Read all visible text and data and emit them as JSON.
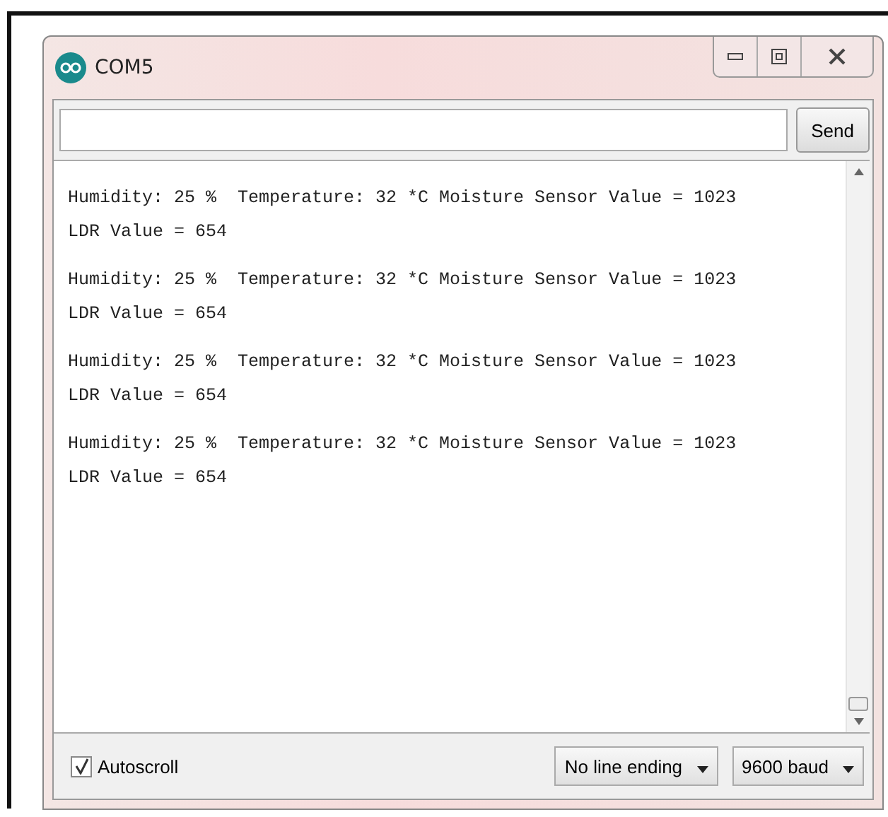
{
  "window": {
    "title": "COM5"
  },
  "send_button": "Send",
  "output": [
    {
      "lines": [
        "Humidity: 25 %  Temperature: 32 *C Moisture Sensor Value = 1023",
        "LDR Value = 654"
      ]
    },
    {
      "lines": [
        "Humidity: 25 %  Temperature: 32 *C Moisture Sensor Value = 1023",
        "LDR Value = 654"
      ]
    },
    {
      "lines": [
        "Humidity: 25 %  Temperature: 32 *C Moisture Sensor Value = 1023",
        "LDR Value = 654"
      ]
    },
    {
      "lines": [
        "Humidity: 25 %  Temperature: 32 *C Moisture Sensor Value = 1023",
        "LDR Value = 654"
      ]
    }
  ],
  "autoscroll": {
    "label": "Autoscroll",
    "checked": true
  },
  "line_ending": "No line ending",
  "baud_rate": "9600 baud"
}
